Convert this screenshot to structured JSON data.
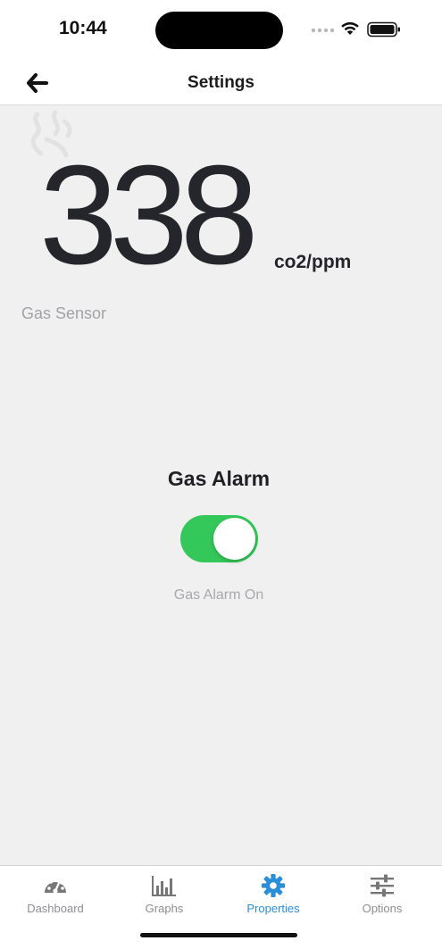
{
  "status_bar": {
    "time": "10:44"
  },
  "nav": {
    "title": "Settings",
    "back_icon": "arrow-left-icon"
  },
  "sensor": {
    "icon": "gas-smoke-icon",
    "value": "338",
    "unit": "co2/ppm",
    "label": "Gas Sensor"
  },
  "alarm": {
    "title": "Gas Alarm",
    "enabled": true,
    "status": "Gas Alarm On"
  },
  "tabs": [
    {
      "label": "Dashboard",
      "icon": "speedometer-icon",
      "active": false
    },
    {
      "label": "Graphs",
      "icon": "bar-chart-icon",
      "active": false
    },
    {
      "label": "Properties",
      "icon": "gear-icon",
      "active": true
    },
    {
      "label": "Options",
      "icon": "sliders-icon",
      "active": false
    }
  ],
  "colors": {
    "accent": "#2b8fd8",
    "toggle_on": "#34c759",
    "background": "#f0f0f0"
  }
}
